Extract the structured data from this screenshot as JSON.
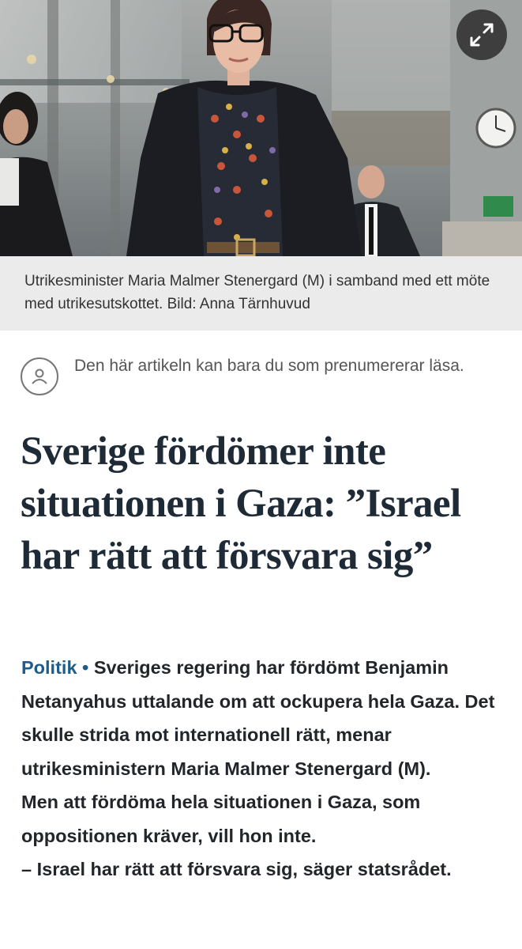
{
  "hero": {
    "expand_icon": "expand-arrows-icon"
  },
  "caption": {
    "text": "Utrikesminister Maria Malmer Stenergard (M) i samband med ett möte med utrikesutskottet. Bild: Anna Tärnhuvud"
  },
  "subscriber": {
    "icon": "user-icon",
    "notice": "Den här artikeln kan bara du som prenumererar läsa."
  },
  "article": {
    "headline": "Sverige fördömer inte situationen i Gaza: ”Israel har rätt att försvara sig”",
    "section": "Politik",
    "separator": "•",
    "lead_intro": "Sveriges regering har fördömt Benjamin Netanyahus uttalande om att ockupera hela Gaza. Det skulle strida mot internationell rätt, menar utrikesministern Maria Malmer Stenergard (M).",
    "lead_p2": "Men att fördöma hela situationen i Gaza, som oppositionen kräver, vill hon inte.",
    "lead_p3": "– Israel har rätt att försvara sig, säger statsrådet."
  }
}
